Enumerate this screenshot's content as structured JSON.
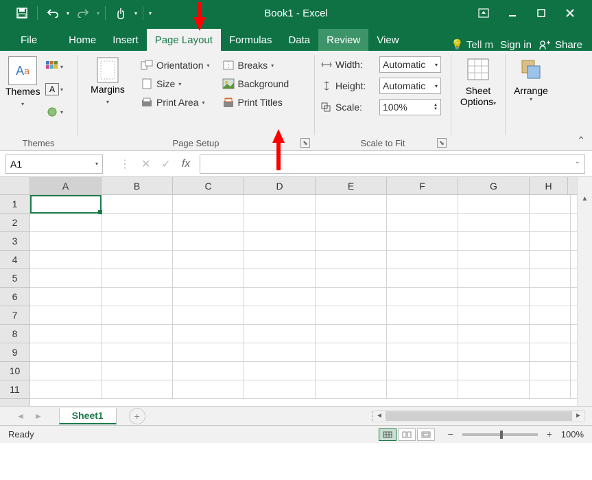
{
  "title": "Book1 - Excel",
  "qat": {
    "save_icon": "save",
    "undo_icon": "undo",
    "redo_icon": "redo",
    "touch_icon": "touch"
  },
  "window_controls": {
    "ribbon_opts": "▭",
    "min": "—",
    "max": "☐",
    "close": "✕"
  },
  "tabs": {
    "file": "File",
    "home": "Home",
    "insert": "Insert",
    "page_layout": "Page Layout",
    "formulas": "Formulas",
    "data": "Data",
    "review": "Review",
    "view": "View"
  },
  "tell_me": "Tell m",
  "signin": "Sign in",
  "share": "Share",
  "ribbon": {
    "themes": {
      "title": "Themes",
      "main": "Themes",
      "caret": "▾",
      "colors": "colors-icon",
      "fonts_box": "A",
      "effects": "effects-icon"
    },
    "page_setup": {
      "title": "Page Setup",
      "margins": "Margins",
      "orientation": "Orientation",
      "size": "Size",
      "print_area": "Print Area",
      "breaks": "Breaks",
      "background": "Background",
      "print_titles": "Print Titles"
    },
    "scale": {
      "title": "Scale to Fit",
      "width": "Width:",
      "height": "Height:",
      "scale": "Scale:",
      "auto": "Automatic",
      "pct": "100%"
    },
    "sheet_opts": "Sheet Options",
    "arrange": "Arrange"
  },
  "namebox": "A1",
  "columns": [
    "A",
    "B",
    "C",
    "D",
    "E",
    "F",
    "G",
    "H"
  ],
  "rows": [
    "1",
    "2",
    "3",
    "4",
    "5",
    "6",
    "7",
    "8",
    "9",
    "10",
    "11"
  ],
  "sheet_tab": "Sheet1",
  "status": "Ready",
  "zoom": "100%"
}
